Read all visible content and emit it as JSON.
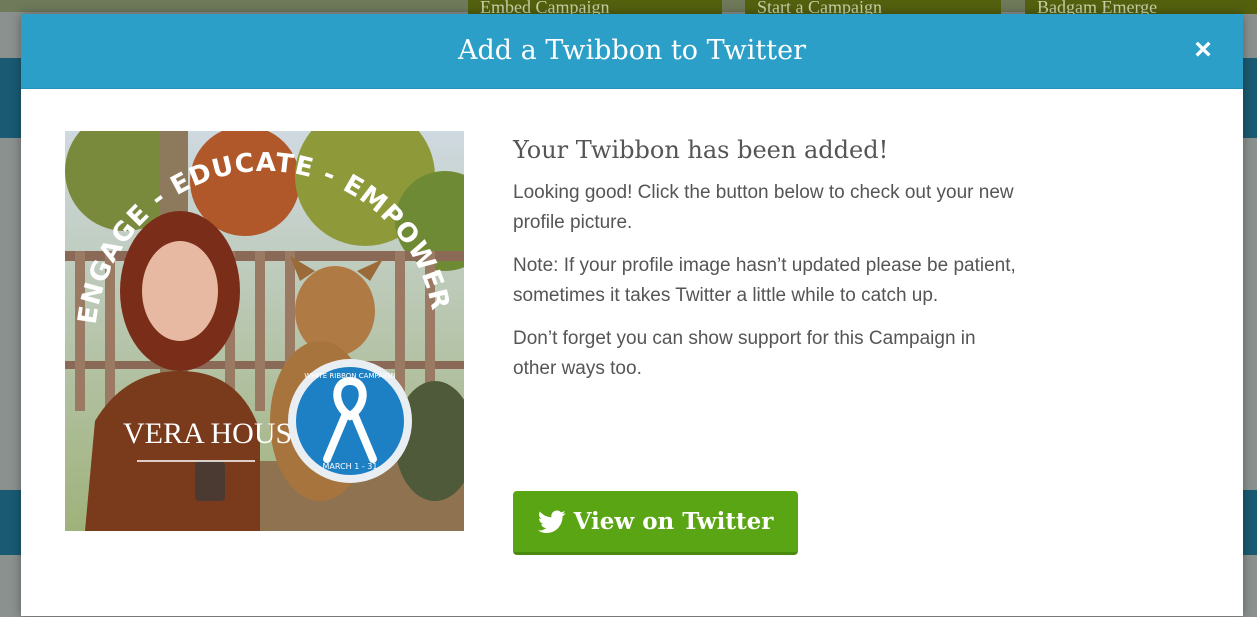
{
  "background": {
    "top_buttons": [
      "Embed Campaign",
      "Start a Campaign",
      "Badgam Emerge"
    ]
  },
  "modal": {
    "title": "Add a Twibbon to Twitter",
    "close_label": "×",
    "heading": "Your Twibbon has been added!",
    "paragraphs": [
      "Looking good! Click the button below to check out your new profile picture.",
      "Note: If your profile image hasn’t updated please be patient, sometimes it takes Twitter a little while to catch up.",
      "Don’t forget you can show support for this Campaign in other ways too."
    ],
    "button_label": "View on Twitter",
    "button_icon": "twitter-bird-icon"
  },
  "preview": {
    "arc_text": "ENGAGE - EDUCATE - EMPOWER",
    "logo_text": "VERA HOUSE",
    "badge_top": "WHITE RIBBON CAMPAIGN",
    "badge_bottom": "MARCH 1 - 31"
  },
  "colors": {
    "header": "#2b9fc8",
    "button": "#5aa514",
    "text": "#555555",
    "badge": "#1d7fc4"
  }
}
